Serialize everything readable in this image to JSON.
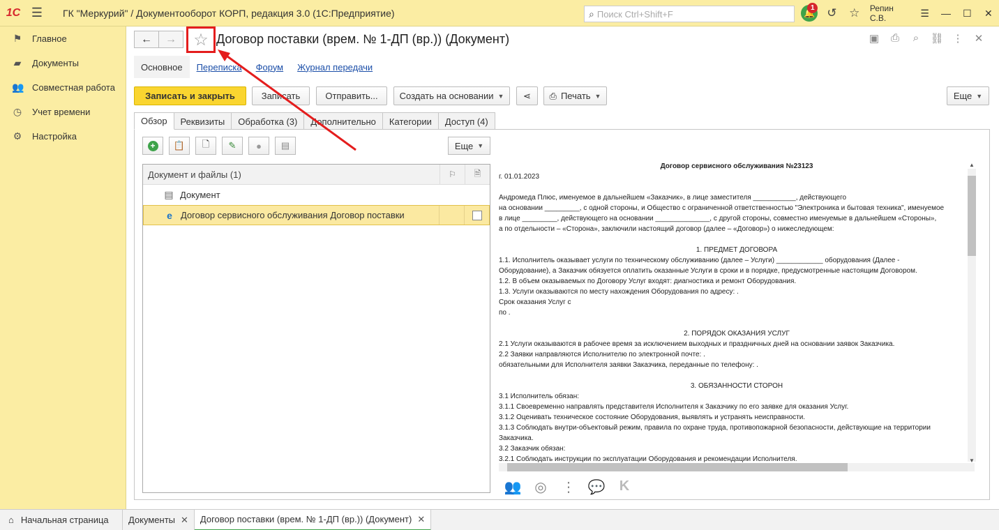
{
  "app": {
    "logo": "1C",
    "title": "ГК \"Меркурий\" / Документооборот КОРП, редакция 3.0  (1С:Предприятие)",
    "search_placeholder": "Поиск Ctrl+Shift+F",
    "notification_count": "1",
    "user": "Репин С.В."
  },
  "sidebar": {
    "items": [
      {
        "label": "Главное",
        "icon": "flag-icon"
      },
      {
        "label": "Документы",
        "icon": "folder-icon"
      },
      {
        "label": "Совместная работа",
        "icon": "users-icon"
      },
      {
        "label": "Учет времени",
        "icon": "clock-icon"
      },
      {
        "label": "Настройка",
        "icon": "sliders-icon"
      }
    ]
  },
  "document": {
    "title": "Договор поставки (врем. № 1-ДП (вр.)) (Документ)",
    "subtabs": [
      "Основное",
      "Переписка",
      "Форум",
      "Журнал передачи"
    ]
  },
  "toolbar": {
    "save_close": "Записать и закрыть",
    "save": "Записать",
    "send": "Отправить...",
    "create_based": "Создать на основании",
    "print": "Печать",
    "more": "Еще"
  },
  "tabs": [
    "Обзор",
    "Реквизиты",
    "Обработка (3)",
    "Дополнительно",
    "Категории",
    "Доступ (4)"
  ],
  "files": {
    "more": "Еще",
    "header": "Документ и файлы (1)",
    "rows": [
      {
        "label": "Документ",
        "icon": "document-icon"
      },
      {
        "label": "Договор сервисного обслуживания Договор поставки",
        "icon": "edge-icon"
      }
    ]
  },
  "preview": {
    "lines": [
      {
        "text": "Договор сервисного обслуживания №23123",
        "style": "center bold"
      },
      {
        "text": "г.                                                                                                                                                              01.01.2023",
        "style": ""
      },
      {
        "text": "",
        "style": ""
      },
      {
        "text": "Андромеда Плюс, именуемое в дальнейшем «Заказчик», в лице заместителя ___________, действующего",
        "style": ""
      },
      {
        "text": " на  основании _________, с одной стороны, и Общество с ограниченной ответственностью \"Электроника и бытовая техника\", именуемое",
        "style": ""
      },
      {
        "text": "в лице _________, действующего на основании ______________, с другой стороны, совместно именуемые в дальнейшем «Стороны»,",
        "style": ""
      },
      {
        "text": "а по отдельности – «Сторона», заключили настоящий договор (далее – «Договор») о нижеследующем:",
        "style": ""
      },
      {
        "text": "",
        "style": ""
      },
      {
        "text": "1. ПРЕДМЕТ ДОГОВОРА",
        "style": "center"
      },
      {
        "text": "1.1. Исполнитель оказывает услуги по техническому обслуживанию (далее – Услуги) ____________ оборудования (Далее -",
        "style": ""
      },
      {
        "text": "Оборудование), а Заказчик обязуется оплатить оказанные Услуги в сроки и в порядке, предусмотренные настоящим Договором.",
        "style": ""
      },
      {
        "text": "1.2. В объем оказываемых по Договору Услуг входят: диагностика и ремонт Оборудования.",
        "style": ""
      },
      {
        "text": "1.3. Услуги оказываются по месту нахождения Оборудования по адресу: .",
        "style": ""
      },
      {
        "text": " Срок оказания Услуг с",
        "style": ""
      },
      {
        "text": "по .",
        "style": ""
      },
      {
        "text": "",
        "style": ""
      },
      {
        "text": "2. ПОРЯДОК ОКАЗАНИЯ УСЛУГ",
        "style": "center"
      },
      {
        "text": "2.1 Услуги оказываются в рабочее время за исключением выходных и праздничных дней на основании заявок Заказчика.",
        "style": ""
      },
      {
        "text": "2.2 Заявки направляются Исполнителю по электронной почте: .",
        "style": ""
      },
      {
        "text": "обязательными для Исполнителя заявки Заказчика, переданные по телефону: .",
        "style": ""
      },
      {
        "text": "",
        "style": ""
      },
      {
        "text": "3. ОБЯЗАННОСТИ СТОРОН",
        "style": "center"
      },
      {
        "text": "3.1  Исполнитель обязан:",
        "style": ""
      },
      {
        "text": "3.1.1 Своевременно направлять представителя Исполнителя к Заказчику по его заявке для оказания Услуг.",
        "style": ""
      },
      {
        "text": "3.1.2 Оценивать техническое состояние Оборудования, выявлять и устранять неисправности.",
        "style": ""
      },
      {
        "text": "3.1.3 Соблюдать внутри-объектовый режим, правила по охране труда, противопожарной безопасности, действующие на территории",
        "style": ""
      },
      {
        "text": "Заказчика.",
        "style": ""
      },
      {
        "text": "3.2 Заказчик обязан:",
        "style": ""
      },
      {
        "text": "3.2.1 Соблюдать инструкции по эксплуатации Оборудования и рекомендации Исполнителя.",
        "style": ""
      }
    ]
  },
  "taskbar": {
    "home": "Начальная страница",
    "tabs": [
      "Документы",
      "Договор поставки (врем. № 1-ДП (вр.)) (Документ)"
    ]
  },
  "colors": {
    "accent_yellow": "#fbeda3",
    "primary_button": "#fad530",
    "annotation_red": "#e41d1d"
  }
}
